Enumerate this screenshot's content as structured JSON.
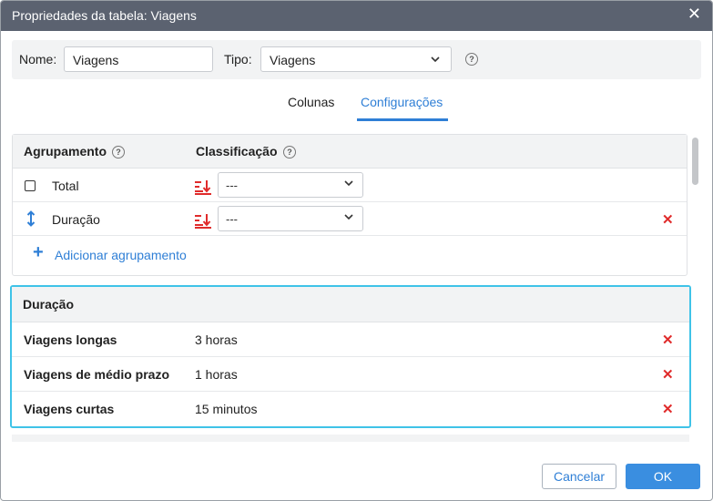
{
  "dialog": {
    "title": "Propriedades da tabela: Viagens",
    "close_glyph": "✕"
  },
  "name_bar": {
    "name_label": "Nome:",
    "name_value": "Viagens",
    "type_label": "Tipo:",
    "type_value": "Viagens",
    "help_glyph": "?"
  },
  "tabs": [
    {
      "label": "Colunas",
      "active": false
    },
    {
      "label": "Configurações",
      "active": true
    }
  ],
  "grouping_panel": {
    "col_grouping": "Agrupamento",
    "col_sorting": "Classificação",
    "rows": [
      {
        "label": "Total",
        "sort_value": "---",
        "icon": "checkbox",
        "deletable": false
      },
      {
        "label": "Duração",
        "sort_value": "---",
        "icon": "updown-arrow-icon",
        "deletable": true
      }
    ],
    "add_label": "Adicionar agrupamento",
    "add_glyph": "+",
    "delete_glyph": "✕",
    "sort_icon": "sort-descending-icon",
    "accent_color": "#e02b2b"
  },
  "interval_panel": {
    "title": "Duração",
    "rows": [
      {
        "name": "Viagens longas",
        "value": "3 horas"
      },
      {
        "name": "Viagens de médio prazo",
        "value": "1 horas"
      },
      {
        "name": "Viagens curtas",
        "value": "15 minutos"
      }
    ],
    "highlight_color": "#3fc3e8"
  },
  "footer": {
    "cancel_label": "Cancelar",
    "ok_label": "OK"
  },
  "colors": {
    "titlebar": "#5b6270",
    "primary": "#2f7fd6",
    "danger": "#e02b2b"
  }
}
